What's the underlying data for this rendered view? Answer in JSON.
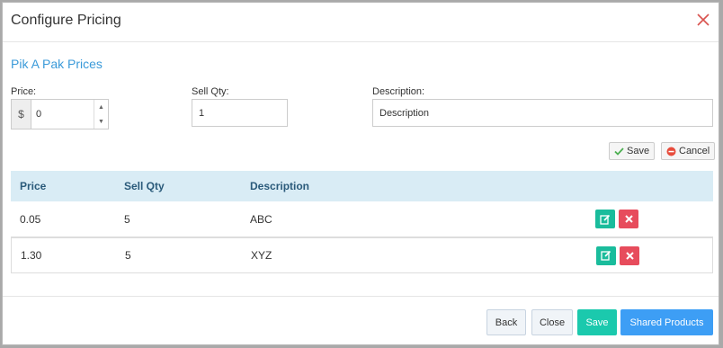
{
  "modal": {
    "title": "Configure Pricing"
  },
  "section": {
    "title": "Pik A Pak Prices"
  },
  "form": {
    "price_label": "Price:",
    "currency_symbol": "$",
    "price_value": "0",
    "qty_label": "Sell Qty:",
    "qty_value": "1",
    "desc_label": "Description:",
    "desc_value": "Description",
    "save_label": "Save",
    "cancel_label": "Cancel"
  },
  "table": {
    "headers": [
      "Price",
      "Sell Qty",
      "Description"
    ],
    "rows": [
      {
        "price": "0.05",
        "qty": "5",
        "description": "ABC"
      },
      {
        "price": "1.30",
        "qty": "5",
        "description": "XYZ"
      }
    ]
  },
  "footer": {
    "back_label": "Back",
    "close_label": "Close",
    "save_label": "Save",
    "shared_label": "Shared Products"
  },
  "colors": {
    "accent_teal": "#1bc9ad",
    "accent_blue": "#3d9ef5",
    "delete_red": "#e74c5c",
    "title_blue": "#3a9ad9",
    "header_bg": "#d9ecf5"
  }
}
